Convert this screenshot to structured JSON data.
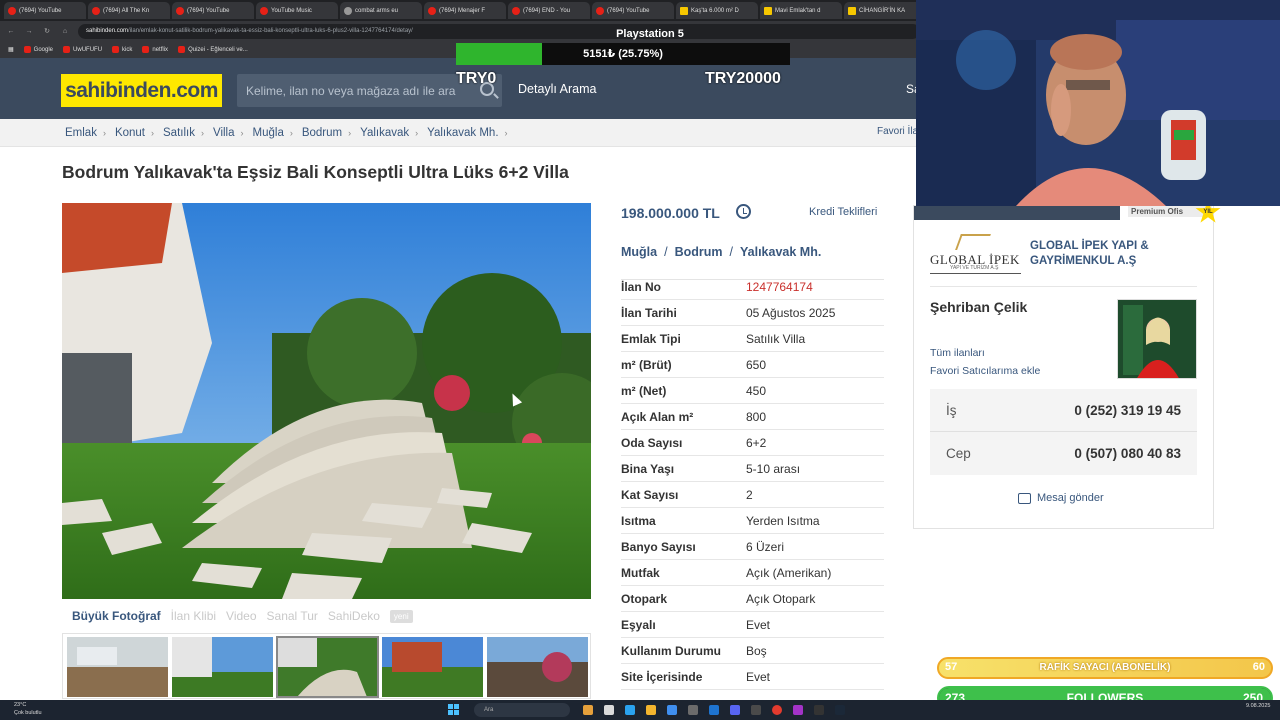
{
  "browser": {
    "tabs": [
      {
        "label": "(7694) YouTube",
        "kind": "yt"
      },
      {
        "label": "(7694) All The Kn",
        "kind": "yt"
      },
      {
        "label": "(7694) YouTube",
        "kind": "yt"
      },
      {
        "label": "YouTube Music",
        "kind": "yt"
      },
      {
        "label": "combat arms eu",
        "kind": "dark"
      },
      {
        "label": "(7694) Menajer F",
        "kind": "yt"
      },
      {
        "label": "(7694) END - You",
        "kind": "yt"
      },
      {
        "label": "(7694) YouTube",
        "kind": "yt"
      },
      {
        "label": "Kaş'ta 6.000 m² D",
        "kind": "yel"
      },
      {
        "label": "Mavi Emlak'tan d",
        "kind": "yel"
      },
      {
        "label": "CİHANGİR'İN KA",
        "kind": "yel"
      }
    ],
    "url_domain": "sahibinden.com",
    "url_path": "/ilan/emlak-konut-satilik-bodrum-yalikavak-ta-essiz-bali-konseptli-ultra-luks-6-plus2-villa-1247764174/detay/",
    "bookmarks": [
      "Google",
      "UwUFUFU",
      "kick",
      "netflix",
      "Quizei - Eğlenceli ve..."
    ]
  },
  "site": {
    "logo": "sahibinden.com",
    "search_placeholder": "Kelime, ilan no veya mağaza adı ile ara",
    "detailed_search": "Detaylı Arama",
    "right_cut": "Sa"
  },
  "overlay": {
    "title": "Playstation 5",
    "progress_text": "5151₺ (25.75%)",
    "progress_fraction": 0.2575,
    "min_label": "TRY0",
    "max_label": "TRY20000"
  },
  "breadcrumbs": [
    "Emlak",
    "Konut",
    "Satılık",
    "Villa",
    "Muğla",
    "Bodrum",
    "Yalıkavak",
    "Yalıkavak Mh."
  ],
  "favorite_cut": "Favori İla",
  "listing": {
    "title": "Bodrum Yalıkavak'ta Eşsiz Bali Konseptli Ultra Lüks 6+2 Villa",
    "price": "198.000.000 TL",
    "credit": "Kredi Teklifleri",
    "location": [
      "Muğla",
      "Bodrum",
      "Yalıkavak Mh."
    ],
    "location_sep": "/",
    "photo_actions": [
      {
        "label": "Büyük Fotoğraf",
        "active": true
      },
      {
        "label": "İlan Klibi",
        "active": false
      },
      {
        "label": "Video",
        "active": false
      },
      {
        "label": "Sanal Tur",
        "active": false
      },
      {
        "label": "SahiDeko",
        "active": false
      }
    ],
    "new_badge": "yeni",
    "details": [
      {
        "key": "İlan No",
        "value": "1247764174",
        "red": true
      },
      {
        "key": "İlan Tarihi",
        "value": "05 Ağustos 2025"
      },
      {
        "key": "Emlak Tipi",
        "value": "Satılık Villa"
      },
      {
        "key": "m² (Brüt)",
        "value": "650"
      },
      {
        "key": "m² (Net)",
        "value": "450"
      },
      {
        "key": "Açık Alan m²",
        "value": "800"
      },
      {
        "key": "Oda Sayısı",
        "value": "6+2"
      },
      {
        "key": "Bina Yaşı",
        "value": "5-10 arası"
      },
      {
        "key": "Kat Sayısı",
        "value": "2"
      },
      {
        "key": "Isıtma",
        "value": "Yerden Isıtma"
      },
      {
        "key": "Banyo Sayısı",
        "value": "6 Üzeri"
      },
      {
        "key": "Mutfak",
        "value": "Açık (Amerikan)"
      },
      {
        "key": "Otopark",
        "value": "Açık Otopark"
      },
      {
        "key": "Eşyalı",
        "value": "Evet"
      },
      {
        "key": "Kullanım Durumu",
        "value": "Boş"
      },
      {
        "key": "Site İçerisinde",
        "value": "Evet"
      }
    ]
  },
  "seller": {
    "premium": "Premium Ofis",
    "years_badge": "YIL",
    "logo_name": "GLOBAL İPEK",
    "logo_sub": "YAPI VE TURİZM A.Ş",
    "company": "GLOBAL İPEK YAPI & GAYRİMENKUL A.Ş",
    "agent": "Şehriban Çelik",
    "all_listings": "Tüm ilanları",
    "add_fav": "Favori Satıcılarıma ekle",
    "phones": [
      {
        "label": "İş",
        "number": "0 (252) 319 19 45"
      },
      {
        "label": "Cep",
        "number": "0 (507) 080 40 83"
      }
    ],
    "message": "Mesaj gönder"
  },
  "stream": {
    "subs_left": "57",
    "subs_label": "RAFİK SAYACI (ABONELİK)",
    "subs_right": "60",
    "followers_left": "273",
    "followers_label": "FOLLOWERS",
    "followers_right": "250"
  },
  "taskbar": {
    "temp": "23°C",
    "weather": "Çok bulutlu",
    "search": "Ara",
    "time": "9.08.2025"
  }
}
